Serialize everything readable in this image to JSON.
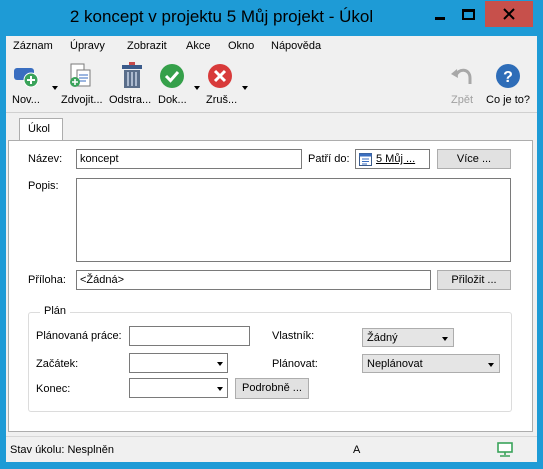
{
  "window": {
    "title": "2 koncept v projektu 5 Můj projekt - Úkol",
    "accent": "#1e9bd6",
    "close_color": "#c7504b"
  },
  "menu": [
    "Záznam",
    "Úpravy",
    "Zobrazit",
    "Akce",
    "Okno",
    "Nápověda"
  ],
  "toolbar": {
    "new_label": "Nov...",
    "duplicate_label": "Zdvojit...",
    "delete_label": "Odstra...",
    "done_label": "Dok...",
    "cancel_label": "Zruš...",
    "undo_label": "Zpět",
    "help_label": "Co je to?"
  },
  "tab": {
    "label": "Úkol"
  },
  "form": {
    "name_label": "Název:",
    "name_value": "koncept",
    "belongs_label": "Patří do:",
    "belongs_value": "5 Můj ...",
    "more_button": "Více ...",
    "description_label": "Popis:",
    "description_value": "",
    "attachment_label": "Příloha:",
    "attachment_value": "<Žádná>",
    "attach_button": "Přiložit ..."
  },
  "plan": {
    "group_title": "Plán",
    "planned_work_label": "Plánovaná práce:",
    "planned_work_value": "",
    "start_label": "Začátek:",
    "start_value": "",
    "end_label": "Konec:",
    "end_value": "",
    "details_button": "Podrobně ...",
    "owner_label": "Vlastník:",
    "owner_value": "Žádný",
    "schedule_label": "Plánovat:",
    "schedule_value": "Neplánovat"
  },
  "status": {
    "state_text": "Stav úkolu: Nesplněn",
    "indicator": "A",
    "network_icon": "network-computer-icon"
  }
}
